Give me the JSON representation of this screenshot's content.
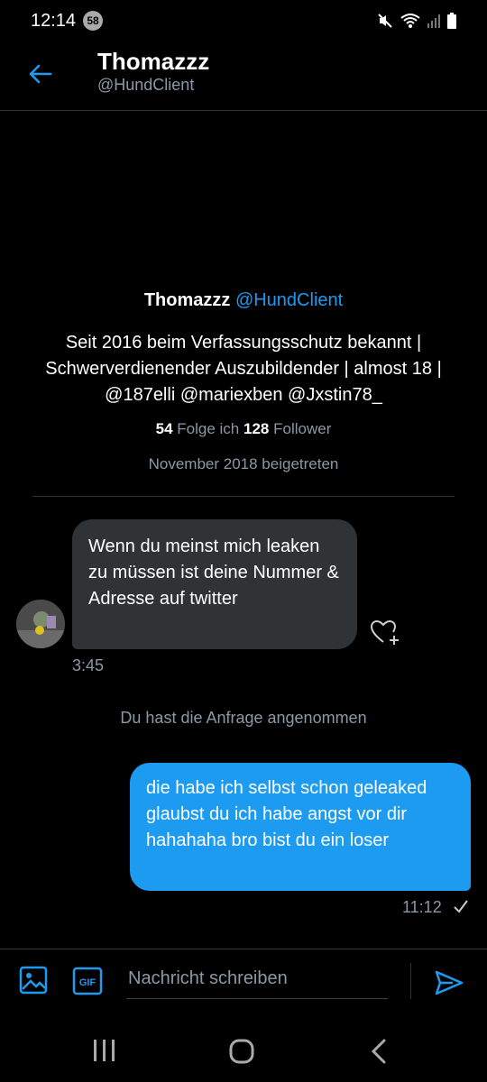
{
  "status_bar": {
    "time": "12:14",
    "notification_count": "58"
  },
  "header": {
    "name": "Thomazzz",
    "handle": "@HundClient"
  },
  "profile": {
    "name": "Thomazzz",
    "handle": "@HundClient",
    "bio": "Seit 2016 beim Verfassungsschutz bekannt | Schwerverdienender Auszubildender | almost 18 | @187elli @mariexben @Jxstin78_",
    "following_count": "54",
    "following_label": "Folge ich",
    "followers_count": "128",
    "followers_label": "Follower",
    "joined": "November 2018 beigetreten"
  },
  "messages": {
    "received": {
      "text": "Wenn du meinst mich leaken zu müssen ist deine Nummer & Adresse auf twitter",
      "time": "3:45"
    },
    "system_note": "Du hast die Anfrage angenommen",
    "sent": {
      "text": "die habe ich selbst schon geleaked glaubst du ich habe angst vor dir hahahaha bro bist du ein loser",
      "time": "11:12"
    }
  },
  "composer": {
    "placeholder": "Nachricht schreiben",
    "gif_label": "GIF"
  },
  "colors": {
    "accent": "#1d9bf0",
    "bubble_received": "#2f3336",
    "muted_text": "#8b98a5",
    "background": "#000000"
  },
  "icons": [
    "notification-badge",
    "mute-icon",
    "wifi-icon",
    "signal-icon",
    "battery-icon",
    "back-arrow-icon",
    "heart-plus-icon",
    "checkmark-icon",
    "image-icon",
    "gif-icon",
    "send-icon",
    "recents-icon",
    "home-icon",
    "nav-back-icon"
  ]
}
